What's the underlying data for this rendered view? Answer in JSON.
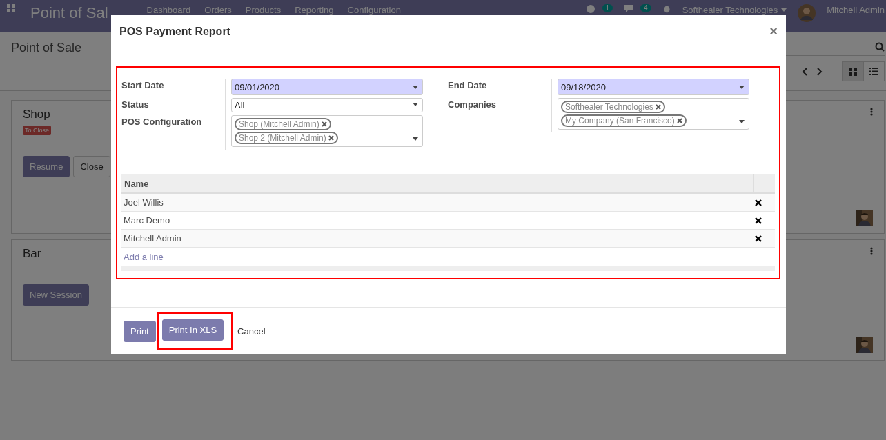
{
  "navbar": {
    "app_title": "Point of Sal",
    "menu": [
      "Dashboard",
      "Orders",
      "Products",
      "Reporting",
      "Configuration"
    ],
    "activity_count": "1",
    "message_count": "4",
    "company": "Softhealer Technologies",
    "user": "Mitchell Admin"
  },
  "control_panel": {
    "breadcrumb": "Point of Sale",
    "views": [
      {
        "kind": "kanban",
        "selected": true
      },
      {
        "kind": "list",
        "selected": false
      }
    ]
  },
  "sessions": [
    {
      "name": "Shop",
      "status": "To Close",
      "buttons": [
        {
          "label": "Resume",
          "kind": "primary"
        },
        {
          "label": "Close",
          "kind": "secondary"
        }
      ]
    },
    {
      "name": "Bar",
      "buttons": [
        {
          "label": "New Session",
          "kind": "primary"
        }
      ]
    }
  ],
  "dialog": {
    "title": "POS Payment Report",
    "close": "×",
    "highlighted": true,
    "fields_left": [
      {
        "label": "Start Date",
        "kind": "date",
        "value": "09/01/2020"
      },
      {
        "label": "Status",
        "kind": "select",
        "value": "All"
      },
      {
        "label": "POS Configuration",
        "kind": "tags",
        "tags": [
          "Shop (Mitchell Admin)",
          "Shop 2 (Mitchell Admin)"
        ]
      }
    ],
    "fields_right": [
      {
        "label": "End Date",
        "kind": "date",
        "value": "09/18/2020"
      },
      {
        "label": "Companies",
        "kind": "tags",
        "tags": [
          "Softhealer Technologies",
          "My Company (San Francisco)"
        ]
      }
    ],
    "table": {
      "columns": [
        "Name"
      ],
      "rows": [
        "Joel Willis",
        "Marc Demo",
        "Mitchell Admin"
      ],
      "add_line": "Add a line"
    },
    "footer": [
      {
        "label": "Print",
        "kind": "primary",
        "highlighted": false
      },
      {
        "label": "Print In XLS",
        "kind": "primary",
        "highlighted": true
      },
      {
        "label": "Cancel",
        "kind": "link",
        "highlighted": false
      }
    ]
  }
}
